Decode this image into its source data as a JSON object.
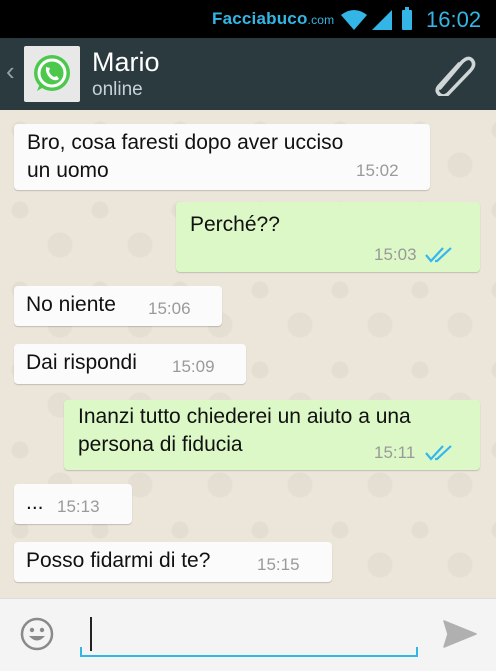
{
  "status_bar": {
    "watermark_main": "Facciabuco",
    "watermark_suffix": ".com",
    "clock": "16:02",
    "icons": [
      "wifi-icon",
      "signal-icon",
      "battery-icon"
    ],
    "accent_color": "#33b5e5"
  },
  "header": {
    "contact_name": "Mario",
    "contact_status": "online",
    "icons": [
      "back-chevron-icon",
      "whatsapp-logo-icon",
      "paperclip-icon"
    ],
    "bg_color": "#2b3a3f"
  },
  "messages": [
    {
      "dir": "in",
      "lines": [
        "Bro, cosa faresti dopo aver ucciso",
        "un uomo"
      ],
      "time": "15:02"
    },
    {
      "dir": "out",
      "lines": [
        "Perché??"
      ],
      "time": "15:03",
      "read": true
    },
    {
      "dir": "in",
      "lines": [
        "No niente"
      ],
      "time": "15:06"
    },
    {
      "dir": "in",
      "lines": [
        "Dai rispondi"
      ],
      "time": "15:09"
    },
    {
      "dir": "out",
      "lines": [
        "Inanzi tutto chiederei un aiuto a una",
        "persona di fiducia"
      ],
      "time": "15:11",
      "read": true
    },
    {
      "dir": "in",
      "lines": [
        "..."
      ],
      "time": "15:13"
    },
    {
      "dir": "in",
      "lines": [
        "Posso fidarmi di te?"
      ],
      "time": "15:15"
    }
  ],
  "input_bar": {
    "value": "",
    "icons": [
      "smiley-icon",
      "send-icon"
    ]
  },
  "colors": {
    "incoming_bubble": "#fbfbfb",
    "outgoing_bubble": "#dcf8c6",
    "read_ticks": "#34b7f1"
  }
}
